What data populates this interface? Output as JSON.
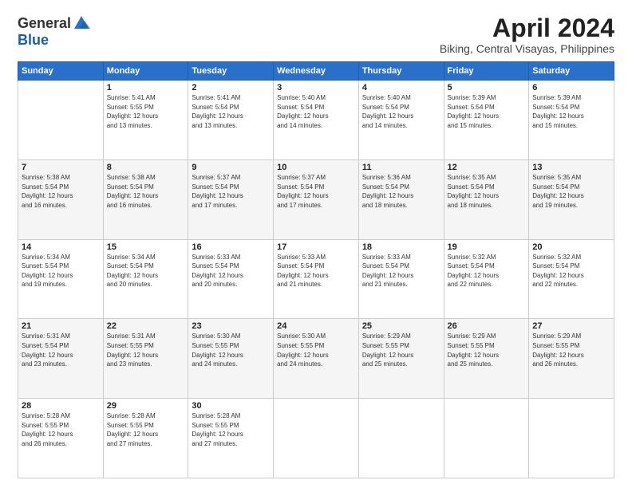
{
  "header": {
    "logo_general": "General",
    "logo_blue": "Blue",
    "title": "April 2024",
    "location": "Biking, Central Visayas, Philippines"
  },
  "columns": [
    "Sunday",
    "Monday",
    "Tuesday",
    "Wednesday",
    "Thursday",
    "Friday",
    "Saturday"
  ],
  "weeks": [
    [
      {
        "day": "",
        "info": ""
      },
      {
        "day": "1",
        "info": "Sunrise: 5:41 AM\nSunset: 5:55 PM\nDaylight: 12 hours\nand 13 minutes."
      },
      {
        "day": "2",
        "info": "Sunrise: 5:41 AM\nSunset: 5:54 PM\nDaylight: 12 hours\nand 13 minutes."
      },
      {
        "day": "3",
        "info": "Sunrise: 5:40 AM\nSunset: 5:54 PM\nDaylight: 12 hours\nand 14 minutes."
      },
      {
        "day": "4",
        "info": "Sunrise: 5:40 AM\nSunset: 5:54 PM\nDaylight: 12 hours\nand 14 minutes."
      },
      {
        "day": "5",
        "info": "Sunrise: 5:39 AM\nSunset: 5:54 PM\nDaylight: 12 hours\nand 15 minutes."
      },
      {
        "day": "6",
        "info": "Sunrise: 5:39 AM\nSunset: 5:54 PM\nDaylight: 12 hours\nand 15 minutes."
      }
    ],
    [
      {
        "day": "7",
        "info": "Sunrise: 5:38 AM\nSunset: 5:54 PM\nDaylight: 12 hours\nand 16 minutes."
      },
      {
        "day": "8",
        "info": "Sunrise: 5:38 AM\nSunset: 5:54 PM\nDaylight: 12 hours\nand 16 minutes."
      },
      {
        "day": "9",
        "info": "Sunrise: 5:37 AM\nSunset: 5:54 PM\nDaylight: 12 hours\nand 17 minutes."
      },
      {
        "day": "10",
        "info": "Sunrise: 5:37 AM\nSunset: 5:54 PM\nDaylight: 12 hours\nand 17 minutes."
      },
      {
        "day": "11",
        "info": "Sunrise: 5:36 AM\nSunset: 5:54 PM\nDaylight: 12 hours\nand 18 minutes."
      },
      {
        "day": "12",
        "info": "Sunrise: 5:35 AM\nSunset: 5:54 PM\nDaylight: 12 hours\nand 18 minutes."
      },
      {
        "day": "13",
        "info": "Sunrise: 5:35 AM\nSunset: 5:54 PM\nDaylight: 12 hours\nand 19 minutes."
      }
    ],
    [
      {
        "day": "14",
        "info": "Sunrise: 5:34 AM\nSunset: 5:54 PM\nDaylight: 12 hours\nand 19 minutes."
      },
      {
        "day": "15",
        "info": "Sunrise: 5:34 AM\nSunset: 5:54 PM\nDaylight: 12 hours\nand 20 minutes."
      },
      {
        "day": "16",
        "info": "Sunrise: 5:33 AM\nSunset: 5:54 PM\nDaylight: 12 hours\nand 20 minutes."
      },
      {
        "day": "17",
        "info": "Sunrise: 5:33 AM\nSunset: 5:54 PM\nDaylight: 12 hours\nand 21 minutes."
      },
      {
        "day": "18",
        "info": "Sunrise: 5:33 AM\nSunset: 5:54 PM\nDaylight: 12 hours\nand 21 minutes."
      },
      {
        "day": "19",
        "info": "Sunrise: 5:32 AM\nSunset: 5:54 PM\nDaylight: 12 hours\nand 22 minutes."
      },
      {
        "day": "20",
        "info": "Sunrise: 5:32 AM\nSunset: 5:54 PM\nDaylight: 12 hours\nand 22 minutes."
      }
    ],
    [
      {
        "day": "21",
        "info": "Sunrise: 5:31 AM\nSunset: 5:54 PM\nDaylight: 12 hours\nand 23 minutes."
      },
      {
        "day": "22",
        "info": "Sunrise: 5:31 AM\nSunset: 5:55 PM\nDaylight: 12 hours\nand 23 minutes."
      },
      {
        "day": "23",
        "info": "Sunrise: 5:30 AM\nSunset: 5:55 PM\nDaylight: 12 hours\nand 24 minutes."
      },
      {
        "day": "24",
        "info": "Sunrise: 5:30 AM\nSunset: 5:55 PM\nDaylight: 12 hours\nand 24 minutes."
      },
      {
        "day": "25",
        "info": "Sunrise: 5:29 AM\nSunset: 5:55 PM\nDaylight: 12 hours\nand 25 minutes."
      },
      {
        "day": "26",
        "info": "Sunrise: 5:29 AM\nSunset: 5:55 PM\nDaylight: 12 hours\nand 25 minutes."
      },
      {
        "day": "27",
        "info": "Sunrise: 5:29 AM\nSunset: 5:55 PM\nDaylight: 12 hours\nand 26 minutes."
      }
    ],
    [
      {
        "day": "28",
        "info": "Sunrise: 5:28 AM\nSunset: 5:55 PM\nDaylight: 12 hours\nand 26 minutes."
      },
      {
        "day": "29",
        "info": "Sunrise: 5:28 AM\nSunset: 5:55 PM\nDaylight: 12 hours\nand 27 minutes."
      },
      {
        "day": "30",
        "info": "Sunrise: 5:28 AM\nSunset: 5:55 PM\nDaylight: 12 hours\nand 27 minutes."
      },
      {
        "day": "",
        "info": ""
      },
      {
        "day": "",
        "info": ""
      },
      {
        "day": "",
        "info": ""
      },
      {
        "day": "",
        "info": ""
      }
    ]
  ]
}
